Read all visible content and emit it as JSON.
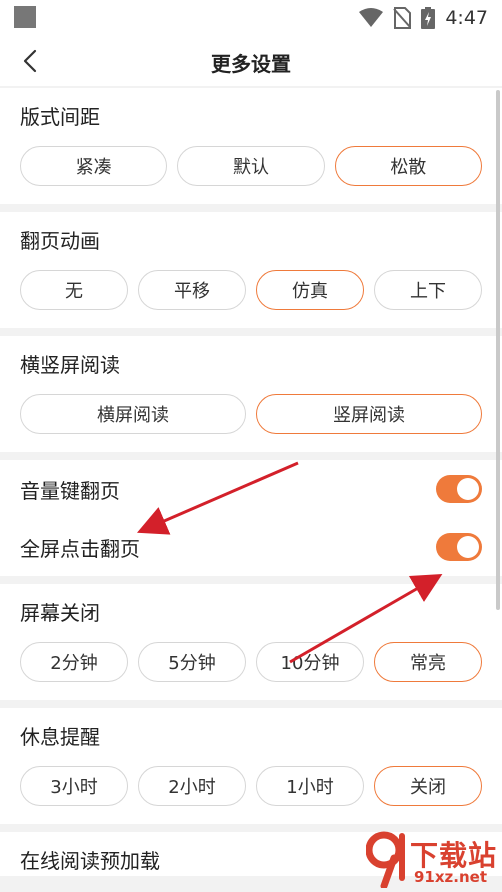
{
  "status": {
    "time": "4:47"
  },
  "header": {
    "title": "更多设置"
  },
  "sections": {
    "layout": {
      "title": "版式间距",
      "options": [
        "紧凑",
        "默认",
        "松散"
      ],
      "selected": "松散"
    },
    "page_turn_anim": {
      "title": "翻页动画",
      "options": [
        "无",
        "平移",
        "仿真",
        "上下"
      ],
      "selected": "仿真"
    },
    "orientation": {
      "title": "横竖屏阅读",
      "options": [
        "横屏阅读",
        "竖屏阅读"
      ],
      "selected": "竖屏阅读"
    },
    "toggles": {
      "volume_key": {
        "label": "音量键翻页",
        "on": true
      },
      "fullscreen_tap": {
        "label": "全屏点击翻页",
        "on": true
      }
    },
    "screen_off": {
      "title": "屏幕关闭",
      "options": [
        "2分钟",
        "5分钟",
        "10分钟",
        "常亮"
      ],
      "selected": "常亮"
    },
    "rest_reminder": {
      "title": "休息提醒",
      "options": [
        "3小时",
        "2小时",
        "1小时",
        "关闭"
      ],
      "selected": "关闭"
    },
    "preload": {
      "title": "在线阅读预加载"
    }
  },
  "colors": {
    "accent": "#ef7a3b",
    "annotation_arrow": "#d3202a"
  },
  "watermark": {
    "title": "下载站",
    "url": "91xz.net"
  }
}
